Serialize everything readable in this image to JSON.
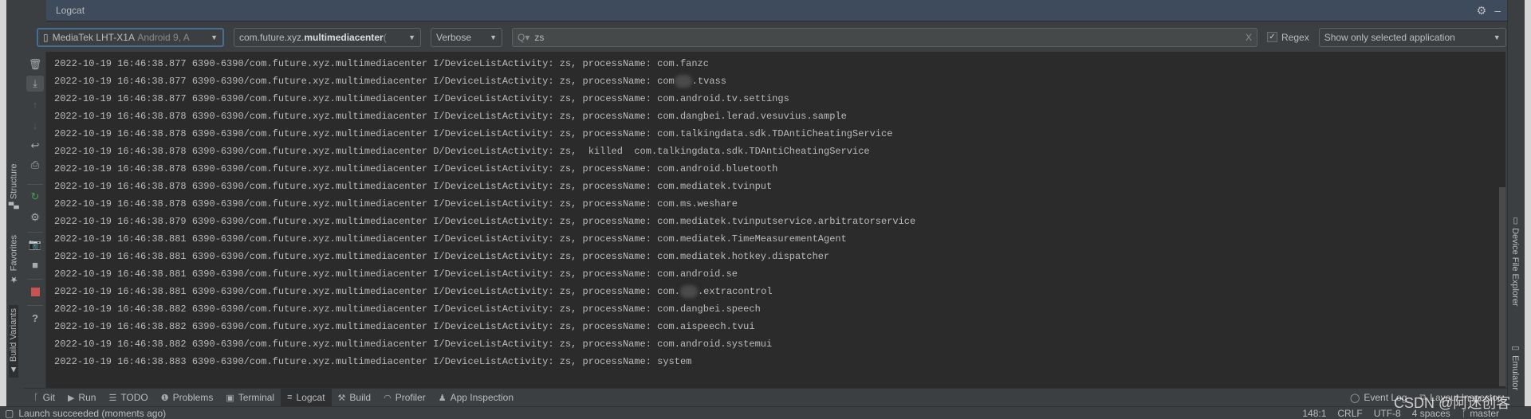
{
  "window": {
    "title": "Logcat"
  },
  "toolbar": {
    "device": {
      "name": "MediaTek LHT-X1A",
      "detail": "Android 9, A"
    },
    "process": {
      "prefix": "com.future.xyz.",
      "bold": "multimediacenter",
      "suffix": " ("
    },
    "log_level": "Verbose",
    "search": {
      "value": "zs",
      "clear": "X"
    },
    "regex": {
      "label": "Regex",
      "checked": true
    },
    "filter": "Show only selected application"
  },
  "left_tabs": [
    "Structure",
    "Favorites",
    "Build Variants"
  ],
  "right_tabs": [
    "Device File Explorer",
    "Emulator"
  ],
  "log_prefix": "2022-10-19 16:46:38.",
  "log_lines": [
    {
      "ms": "877",
      "pid": "6390-6390/com.future.xyz.multimediacenter",
      "tag": "I/DeviceListActivity:",
      "msg": " zs, processName: com.fanzc"
    },
    {
      "ms": "877",
      "pid": "6390-6390/com.future.xyz.multimediacenter",
      "tag": "I/DeviceListActivity:",
      "msg": " zs, processName: com",
      "redacted": true,
      "after": ".tvass"
    },
    {
      "ms": "877",
      "pid": "6390-6390/com.future.xyz.multimediacenter",
      "tag": "I/DeviceListActivity:",
      "msg": " zs, processName: com.android.tv.settings"
    },
    {
      "ms": "878",
      "pid": "6390-6390/com.future.xyz.multimediacenter",
      "tag": "I/DeviceListActivity:",
      "msg": " zs, processName: com.dangbei.lerad.vesuvius.sample"
    },
    {
      "ms": "878",
      "pid": "6390-6390/com.future.xyz.multimediacenter",
      "tag": "I/DeviceListActivity:",
      "msg": " zs, processName: com.talkingdata.sdk.TDAntiCheatingService"
    },
    {
      "ms": "878",
      "pid": "6390-6390/com.future.xyz.multimediacenter",
      "tag": "D/DeviceListActivity:",
      "msg": " zs,  killed  com.talkingdata.sdk.TDAntiCheatingService"
    },
    {
      "ms": "878",
      "pid": "6390-6390/com.future.xyz.multimediacenter",
      "tag": "I/DeviceListActivity:",
      "msg": " zs, processName: com.android.bluetooth"
    },
    {
      "ms": "878",
      "pid": "6390-6390/com.future.xyz.multimediacenter",
      "tag": "I/DeviceListActivity:",
      "msg": " zs, processName: com.mediatek.tvinput"
    },
    {
      "ms": "878",
      "pid": "6390-6390/com.future.xyz.multimediacenter",
      "tag": "I/DeviceListActivity:",
      "msg": " zs, processName: com.ms.weshare"
    },
    {
      "ms": "879",
      "pid": "6390-6390/com.future.xyz.multimediacenter",
      "tag": "I/DeviceListActivity:",
      "msg": " zs, processName: com.mediatek.tvinputservice.arbitratorservice"
    },
    {
      "ms": "881",
      "pid": "6390-6390/com.future.xyz.multimediacenter",
      "tag": "I/DeviceListActivity:",
      "msg": " zs, processName: com.mediatek.TimeMeasurementAgent"
    },
    {
      "ms": "881",
      "pid": "6390-6390/com.future.xyz.multimediacenter",
      "tag": "I/DeviceListActivity:",
      "msg": " zs, processName: com.mediatek.hotkey.dispatcher"
    },
    {
      "ms": "881",
      "pid": "6390-6390/com.future.xyz.multimediacenter",
      "tag": "I/DeviceListActivity:",
      "msg": " zs, processName: com.android.se"
    },
    {
      "ms": "881",
      "pid": "6390-6390/com.future.xyz.multimediacenter",
      "tag": "I/DeviceListActivity:",
      "msg": " zs, processName: com.",
      "redacted": true,
      "after": ".extracontrol"
    },
    {
      "ms": "882",
      "pid": "6390-6390/com.future.xyz.multimediacenter",
      "tag": "I/DeviceListActivity:",
      "msg": " zs, processName: com.dangbei.speech"
    },
    {
      "ms": "882",
      "pid": "6390-6390/com.future.xyz.multimediacenter",
      "tag": "I/DeviceListActivity:",
      "msg": " zs, processName: com.aispeech.tvui"
    },
    {
      "ms": "882",
      "pid": "6390-6390/com.future.xyz.multimediacenter",
      "tag": "I/DeviceListActivity:",
      "msg": " zs, processName: com.android.systemui"
    },
    {
      "ms": "883",
      "pid": "6390-6390/com.future.xyz.multimediacenter",
      "tag": "I/DeviceListActivity:",
      "msg": " zs, processName: system"
    }
  ],
  "bottom_tabs": [
    {
      "label": "Git",
      "icon": "git-icon"
    },
    {
      "label": "Run",
      "icon": "run-icon"
    },
    {
      "label": "TODO",
      "icon": "todo-icon"
    },
    {
      "label": "Problems",
      "icon": "problems-icon"
    },
    {
      "label": "Terminal",
      "icon": "terminal-icon"
    },
    {
      "label": "Logcat",
      "icon": "logcat-icon",
      "active": true
    },
    {
      "label": "Build",
      "icon": "build-icon"
    },
    {
      "label": "Profiler",
      "icon": "profiler-icon"
    },
    {
      "label": "App Inspection",
      "icon": "app-inspection-icon"
    }
  ],
  "bottom_right_tabs": [
    "Event Log",
    "Layout Inspector"
  ],
  "status": {
    "message": "Launch succeeded (moments ago)",
    "position": "148:1",
    "line_sep": "CRLF",
    "encoding": "UTF-8",
    "indent": "4 spaces",
    "branch": "master"
  },
  "watermark": "CSDN @阿迷创客",
  "colors": {
    "title_bar": "#3d4b5c",
    "log_bg": "#2b2b2b",
    "panel": "#3c3f41",
    "stop": "#c75450",
    "rerun": "#499c54"
  }
}
